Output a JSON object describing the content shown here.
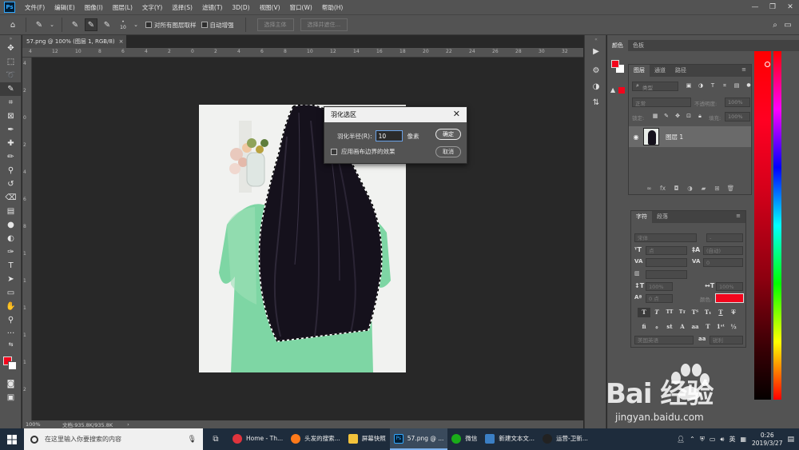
{
  "menubar": {
    "logo": "Ps",
    "items": [
      "文件(F)",
      "编辑(E)",
      "图像(I)",
      "图层(L)",
      "文字(Y)",
      "选择(S)",
      "滤镜(T)",
      "3D(D)",
      "视图(V)",
      "窗口(W)",
      "帮助(H)"
    ]
  },
  "optionsbar": {
    "brush_size": "10",
    "sample_all_layers": "对所有图层取样",
    "auto_enhance": "自动增强",
    "select_subject": "选择主体",
    "select_and_mask": "选择并遮住..."
  },
  "document": {
    "tab_title": "57.png @ 100% (图层 1, RGB/8)",
    "tab_close": "×",
    "zoom": "100%",
    "doc_info": "文档:935.8K/935.8K",
    "ruler_top": [
      "4",
      "12",
      "10",
      "8",
      "6",
      "4",
      "2",
      "0",
      "2",
      "4",
      "6",
      "8",
      "10",
      "12",
      "14",
      "16",
      "18",
      "20",
      "22",
      "24",
      "26",
      "28",
      "30",
      "32"
    ],
    "ruler_left": [
      "4",
      "2",
      "0",
      "2",
      "4",
      "6",
      "8",
      "1",
      "1",
      "1",
      "1",
      "1",
      "2"
    ]
  },
  "dialog": {
    "title": "羽化选区",
    "close": "✕",
    "radius_label": "羽化半径(R):",
    "radius_value": "10",
    "unit": "像素",
    "ok": "确定",
    "cancel": "取消",
    "apply_canvas_bounds": "应用画布边界的效果"
  },
  "color_panel": {
    "tabs": [
      "颜色",
      "色板"
    ],
    "foreground": "#f2051c",
    "background": "#ffffff"
  },
  "layers_panel": {
    "tabs": [
      "图层",
      "通道",
      "路径"
    ],
    "filter_placeholder": "类型",
    "blend_mode": "正常",
    "opacity_label": "不透明度:",
    "opacity_value": "100%",
    "lock_label": "锁定:",
    "fill_label": "填充:",
    "fill_value": "100%",
    "layer_name": "图层 1"
  },
  "character_panel": {
    "tabs": [
      "字符",
      "段落"
    ],
    "font_family": "宋体",
    "font_style": "-",
    "size": "点",
    "leading": "(自动)",
    "tracking": "0",
    "vertical_scale": "100%",
    "horizontal_scale": "100%",
    "baseline": "0 点",
    "color_label": "颜色:",
    "language": "美国英语",
    "antialias": "aa",
    "antialias_value": "锐利",
    "color": "#f2051c"
  },
  "taskbar": {
    "search_placeholder": "在这里输入你要搜索的内容",
    "apps": [
      {
        "label": "Home - Th...",
        "color": "#e0343d"
      },
      {
        "label": "头发的搜索...",
        "color": "#ff7a1a"
      },
      {
        "label": "屏幕快照",
        "color": "#f3c33b"
      },
      {
        "label": "57.png @ ...",
        "color": "#001e36"
      },
      {
        "label": "微信",
        "color": "#1aad19"
      },
      {
        "label": "新建文本文...",
        "color": "#3b7fc4"
      },
      {
        "label": "运营-卫新...",
        "color": "#222222"
      }
    ],
    "ime": "英",
    "time": "0:26",
    "date": "2019/3/27"
  },
  "watermark": {
    "brand": "Bai 经验",
    "url": "jingyan.baidu.com"
  }
}
